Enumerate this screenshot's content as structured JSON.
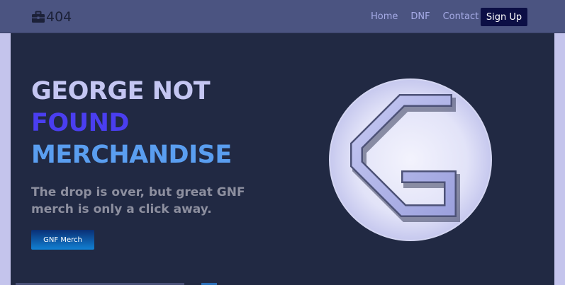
{
  "navbar": {
    "brand_text": "404",
    "links": [
      "Home",
      "DNF",
      "Contact"
    ],
    "signup_label": "Sign Up"
  },
  "hero": {
    "title_line1": "GEORGE NOT",
    "title_line2": "FOUND",
    "title_line3": "MERCHANDISE",
    "subtitle": "The drop is over, but great GNF merch is only a click away.",
    "button_label": "GNF Merch"
  },
  "icons": {
    "brand": "briefcase-icon",
    "logo": "gnf-g-logo"
  },
  "colors": {
    "nav_bg": "#4b5481",
    "hero_bg": "#212943",
    "title_primary": "#c4c6f2",
    "title_accent": "#4a3ef0",
    "title_secondary": "#5a9ef0",
    "signup_bg": "#0c0f45"
  }
}
